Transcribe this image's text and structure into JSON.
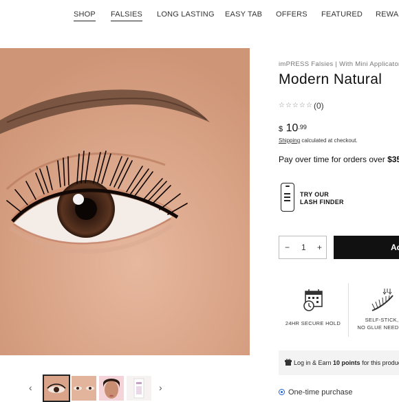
{
  "nav": {
    "items": [
      "SHOP",
      "FALSIES",
      "LONG LASTING",
      "EASY TAB",
      "OFFERS",
      "FEATURED",
      "REWARDS"
    ]
  },
  "product": {
    "brand_line": "imPRESS Falsies | With Mini Applicator",
    "title": "Modern Natural",
    "stars": "☆☆☆☆☆",
    "review_count": "(0)",
    "price_currency": "$",
    "price_whole": "10",
    "price_cents": ".99",
    "shipping_link": "Shipping",
    "shipping_rest": " calculated at checkout.",
    "payover_text": "Pay over time for orders over ",
    "payover_amount": "$35"
  },
  "lash_finder": {
    "line1": "TRY OUR",
    "line2": "LASH FINDER"
  },
  "purchase": {
    "qty_minus": "−",
    "qty_value": "1",
    "qty_plus": "+",
    "add_button": "Ad"
  },
  "perks": [
    {
      "label": "24HR SECURE HOLD",
      "icon": "calendar-clock-icon"
    },
    {
      "label_line1": "SELF-STICK,",
      "label_line2": "NO GLUE NEEDED",
      "icon": "lash-applicator-icon"
    }
  ],
  "loyalty": {
    "prefix": "Log in & Earn ",
    "points": "10 points",
    "suffix": " for this product"
  },
  "purchase_option": {
    "label": "One-time purchase"
  },
  "thumbnails": {
    "prev": "‹",
    "next": "›"
  },
  "colors": {
    "accent": "#1f5fd6",
    "button": "#111111",
    "skin": "#dba587"
  }
}
